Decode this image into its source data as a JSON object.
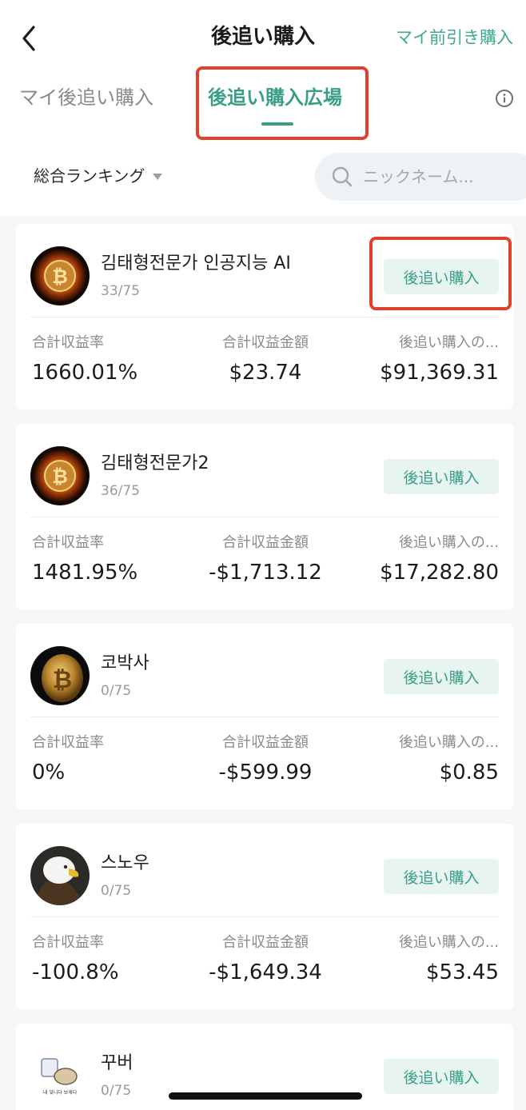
{
  "header": {
    "title": "後追い購入",
    "discount_link": "マイ前引き購入"
  },
  "tabs": {
    "mine": "マイ後追い購入",
    "square": "後追い購入広場"
  },
  "filter": {
    "ranking_label": "総合ランキング",
    "search_placeholder": "ニックネーム..."
  },
  "stat_labels": {
    "total_return_rate": "合計収益率",
    "total_return_amount": "合計収益金額",
    "follow_amount": "後追い購入の..."
  },
  "follow_button_label": "後追い購入",
  "traders": [
    {
      "name": "김태형전문가 인공지능 AI",
      "count": "33/75",
      "avatar": "bitcoin-fire-avatar",
      "return_rate": "1660.01%",
      "return_amount": "$23.74",
      "follow_amount": "$91,369.31"
    },
    {
      "name": "김태형전문가2",
      "count": "36/75",
      "avatar": "bitcoin-fire-avatar",
      "return_rate": "1481.95%",
      "return_amount": "-$1,713.12",
      "follow_amount": "$17,282.80"
    },
    {
      "name": "코박사",
      "count": "0/75",
      "avatar": "gold-bitcoin-avatar",
      "return_rate": "0%",
      "return_amount": "-$599.99",
      "follow_amount": "$0.85"
    },
    {
      "name": "스노우",
      "count": "0/75",
      "avatar": "eagle-avatar",
      "return_rate": "-100.8%",
      "return_amount": "-$1,649.34",
      "follow_amount": "$53.45"
    },
    {
      "name": "꾸버",
      "count": "0/75",
      "avatar": "cartoon-avatar",
      "avatar_caption": "내 잊니다 보세다"
    }
  ],
  "colors": {
    "accent": "#3a9e87",
    "highlight_box": "#e0412d",
    "follow_button_bg": "#e7f4f0"
  }
}
